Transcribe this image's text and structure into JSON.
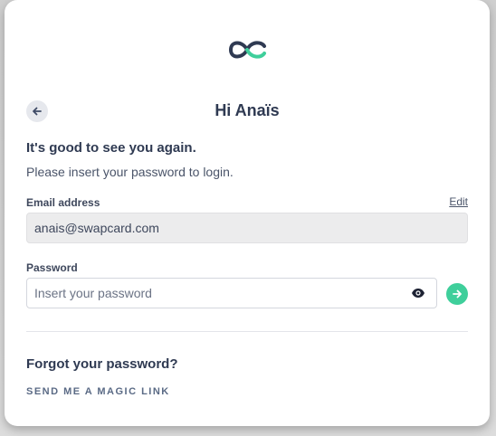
{
  "login": {
    "greeting": "Hi Anaïs",
    "headline": "It's good to see you again.",
    "subtext": "Please insert your password to login.",
    "email": {
      "label": "Email address",
      "edit_label": "Edit",
      "value": "anais@swapcard.com"
    },
    "password": {
      "label": "Password",
      "placeholder": "Insert your password"
    },
    "forgot_heading": "Forgot your password?",
    "magic_link_label": "SEND ME A MAGIC LINK"
  },
  "icons": {
    "logo": "swapcard-logo",
    "back": "arrow-left-icon",
    "eye": "eye-icon",
    "submit": "arrow-right-icon"
  },
  "colors": {
    "accent": "#3fcf9b",
    "text_dark": "#2f3a52",
    "logo_dark": "#2f3a52"
  }
}
